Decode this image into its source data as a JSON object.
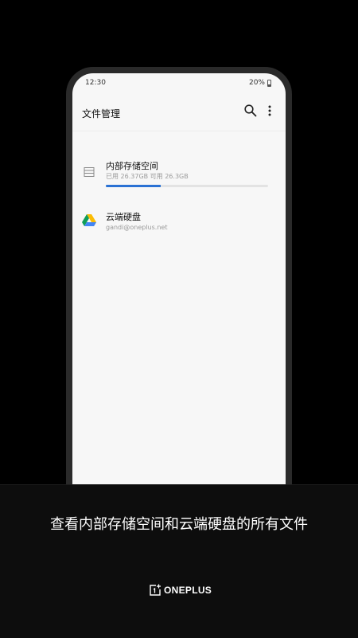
{
  "status_bar": {
    "time": "12:30",
    "battery": "20%"
  },
  "app_bar": {
    "title": "文件管理"
  },
  "storage": {
    "title": "内部存储空间",
    "subtitle": "已用 26.37GB 可用 26.3GB",
    "used_fraction": 0.34
  },
  "drive": {
    "title": "云端硬盘",
    "subtitle": "gandi@oneplus.net"
  },
  "caption": "查看内部存储空间和云端硬盘的所有文件",
  "brand": "ONEPLUS",
  "colors": {
    "accent": "#2b72d4",
    "background": "#000000",
    "screen": "#f7f7f7"
  },
  "icons": [
    "battery-icon",
    "search-icon",
    "more-vert-icon",
    "storage-icon",
    "google-drive-icon",
    "oneplus-logo-icon"
  ]
}
